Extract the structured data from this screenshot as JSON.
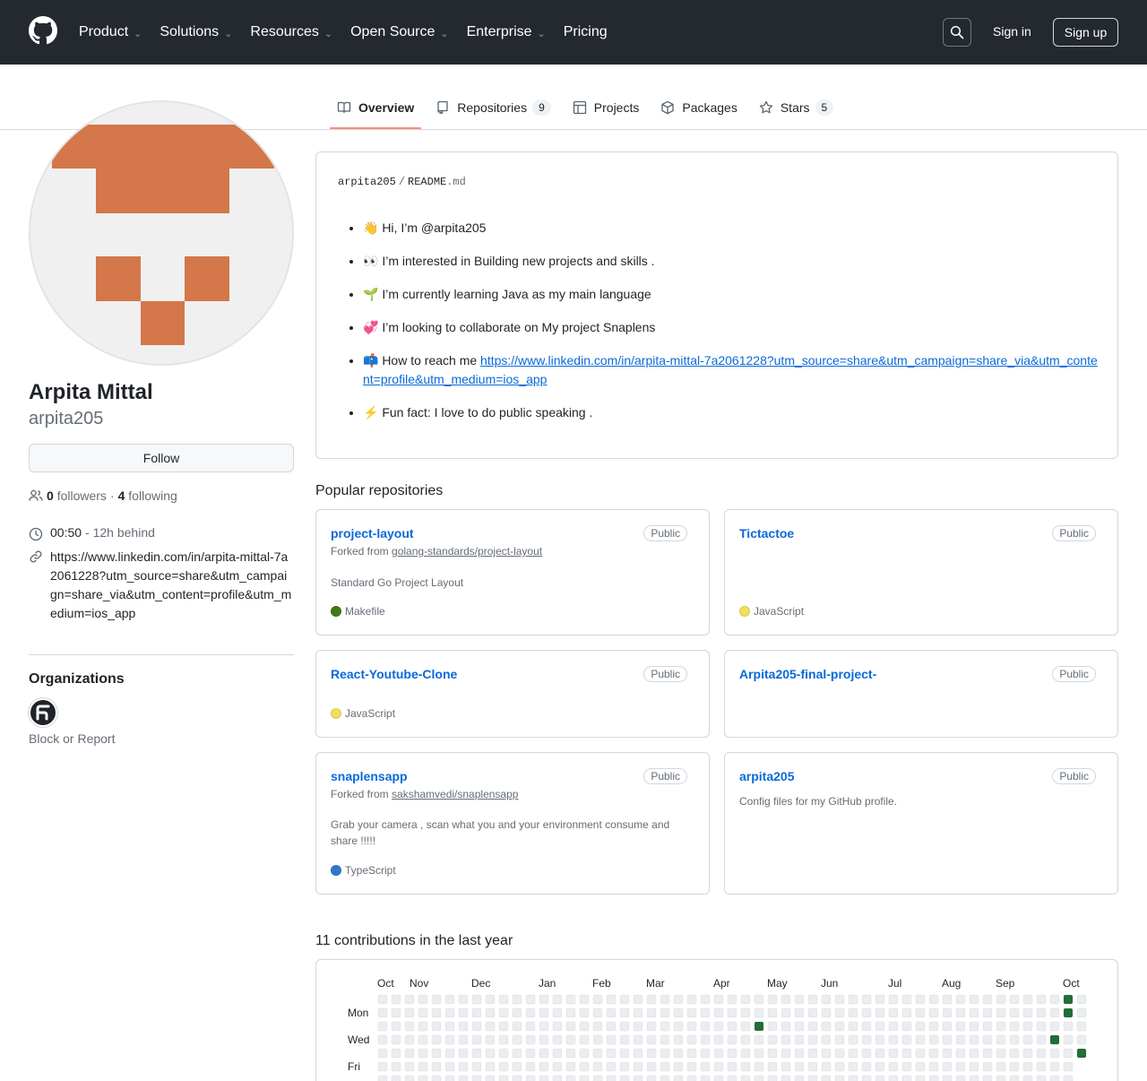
{
  "header": {
    "nav": [
      {
        "label": "Product",
        "has_menu": true
      },
      {
        "label": "Solutions",
        "has_menu": true
      },
      {
        "label": "Resources",
        "has_menu": true
      },
      {
        "label": "Open Source",
        "has_menu": true
      },
      {
        "label": "Enterprise",
        "has_menu": true
      },
      {
        "label": "Pricing",
        "has_menu": false
      }
    ],
    "sign_in": "Sign in",
    "sign_up": "Sign up",
    "icons": {
      "logo": "github-logo",
      "search": "search-icon"
    }
  },
  "tabs": [
    {
      "label": "Overview",
      "active": true,
      "icon": "book-icon"
    },
    {
      "label": "Repositories",
      "count": "9",
      "icon": "repo-icon"
    },
    {
      "label": "Projects",
      "icon": "table-icon"
    },
    {
      "label": "Packages",
      "icon": "package-icon"
    },
    {
      "label": "Stars",
      "count": "5",
      "icon": "star-icon"
    }
  ],
  "profile": {
    "full_name": "Arpita Mittal",
    "username": "arpita205",
    "follow_label": "Follow",
    "followers_count": "0",
    "followers_label": "followers",
    "dot": "·",
    "following_count": "4",
    "following_label": "following",
    "local_time": "00:50",
    "time_behind": "- 12h behind",
    "link": "https://www.linkedin.com/in/arpita-mittal-7a2061228?utm_source=share&utm_campaign=share_via&utm_content=profile&utm_medium=ios_app",
    "organizations_heading": "Organizations",
    "block_report": "Block or Report",
    "avatar_color": "#d4774a"
  },
  "readme": {
    "owner": "arpita205",
    "separator": "/",
    "file": "README",
    "ext": ".md",
    "items": [
      {
        "text": "👋 Hi, I’m @arpita205"
      },
      {
        "text": "👀 I’m interested in Building new projects and skills ."
      },
      {
        "text": "🌱 I’m currently learning Java as my main language"
      },
      {
        "text": "💞️ I’m looking to collaborate on My project Snaplens"
      },
      {
        "text": "📫 How to reach me ",
        "link": "https://www.linkedin.com/in/arpita-mittal-7a2061228?utm_source=share&utm_campaign=share_via&utm_content=profile&utm_medium=ios_app"
      },
      {
        "text": "⚡ Fun fact: I love to do public speaking ."
      }
    ]
  },
  "popular": {
    "heading": "Popular repositories",
    "repos": [
      {
        "name": "project-layout",
        "badge": "Public",
        "forked_prefix": "Forked from ",
        "forked_from": "golang-standards/project-layout",
        "description": "Standard Go Project Layout",
        "language": "Makefile",
        "lang_color": "#427819"
      },
      {
        "name": "Tictactoe",
        "badge": "Public",
        "description": "",
        "language": "JavaScript",
        "lang_color": "#f1e05a"
      },
      {
        "name": "React-Youtube-Clone",
        "badge": "Public",
        "description": "",
        "language": "JavaScript",
        "lang_color": "#f1e05a"
      },
      {
        "name": "Arpita205-final-project-",
        "badge": "Public",
        "description": ""
      },
      {
        "name": "snaplensapp",
        "badge": "Public",
        "forked_prefix": "Forked from ",
        "forked_from": "sakshamvedi/snaplensapp",
        "description": "Grab your camera , scan what you and your environment consume and share !!!!!",
        "language": "TypeScript",
        "lang_color": "#3178c6"
      },
      {
        "name": "arpita205",
        "badge": "Public",
        "description": "Config files for my GitHub profile."
      }
    ]
  },
  "contributions": {
    "heading": "11 contributions in the last year",
    "months": [
      "Oct",
      "Nov",
      "Dec",
      "Jan",
      "Feb",
      "Mar",
      "Apr",
      "May",
      "Jun",
      "Jul",
      "Aug",
      "Sep",
      "Oct"
    ],
    "day_labels": [
      "Mon",
      "Wed",
      "Fri"
    ],
    "empty_color": "#ebedf0",
    "active_color": "#216e39",
    "active_cells": [
      {
        "week": 51,
        "day": 0
      },
      {
        "week": 51,
        "day": 1
      },
      {
        "week": 28,
        "day": 2
      },
      {
        "week": 50,
        "day": 3
      },
      {
        "week": 52,
        "day": 4
      }
    ]
  }
}
